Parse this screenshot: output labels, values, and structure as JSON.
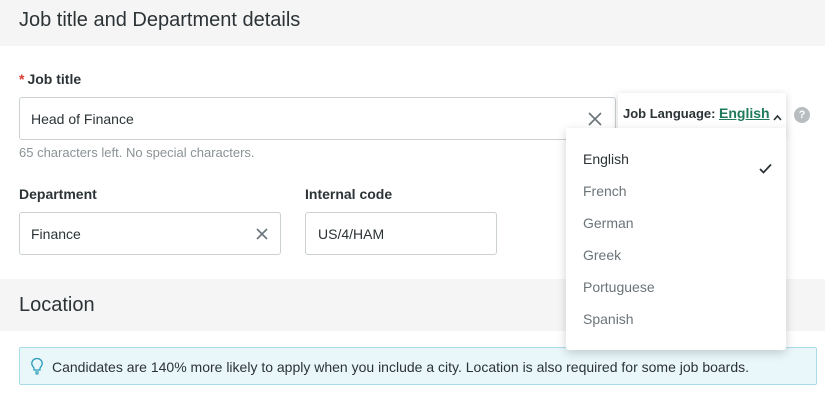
{
  "section_job": {
    "title": "Job title and Department details"
  },
  "job_title": {
    "label": "Job title",
    "value": "Head of Finance",
    "hint": "65 characters left. No special characters."
  },
  "job_language": {
    "label": "Job Language:",
    "value": "English",
    "options": [
      "English",
      "French",
      "German",
      "Greek",
      "Portuguese",
      "Spanish"
    ],
    "selected": "English"
  },
  "department": {
    "label": "Department",
    "value": "Finance"
  },
  "internal_code": {
    "label": "Internal code",
    "value": "US/4/HAM"
  },
  "section_location": {
    "title": "Location"
  },
  "location_tip": {
    "text": "Candidates are 140% more likely to apply when you include a city. Location is also required for some job boards."
  },
  "colors": {
    "accent": "#1f7a5c",
    "required": "#d93b2f",
    "alert_bg": "#e9f7fb"
  },
  "icons": [
    "close-icon",
    "chevron-up-icon",
    "help-icon",
    "check-icon",
    "lightbulb-icon"
  ]
}
